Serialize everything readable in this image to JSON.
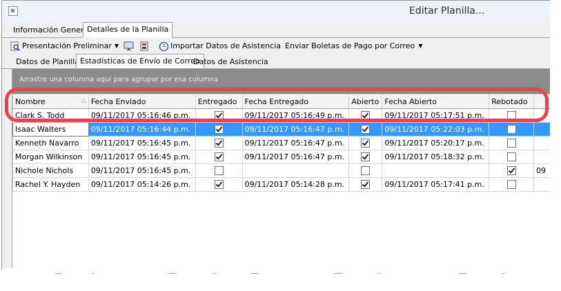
{
  "window": {
    "title": "Editar Planilla..."
  },
  "main_tabs": [
    {
      "label": "Información General"
    },
    {
      "label": "Detalles de la Planilla"
    }
  ],
  "toolbar": {
    "preview_label": "Presentación Preliminar",
    "import_label": "Importar Datos de Asistencia",
    "send_label": "Enviar Boletas de Pago por Correo"
  },
  "sub_tabs": [
    {
      "label": "Datos de Planilla"
    },
    {
      "label": "Estadísticas de Envío de Correo"
    },
    {
      "label": "Datos de Asistencia"
    }
  ],
  "group_panel_text": "Arrastre una columna aquí para agrupar por esa columna",
  "columns": [
    "Nombre",
    "Fecha Enviado",
    "Entregado",
    "Fecha Entregado",
    "Abierto",
    "Fecha Abierto",
    "Rebotado"
  ],
  "rows": [
    {
      "name": "Clark S. Todd",
      "sent": "09/11/2017 05:16:46 p.m.",
      "delivered": true,
      "delivered_date": "09/11/2017 05:16:49 p.m.",
      "opened": true,
      "opened_date": "09/11/2017 05:17:51 p.m.",
      "bounced": false,
      "extra": ""
    },
    {
      "name": "Isaac Walters",
      "sent": "09/11/2017 05:16:44 p.m.",
      "delivered": true,
      "delivered_date": "09/11/2017 05:16:47 p.m.",
      "opened": true,
      "opened_date": "09/11/2017 05:22:03 p.m.",
      "bounced": false,
      "extra": ""
    },
    {
      "name": "Kenneth Navarro",
      "sent": "09/11/2017 05:16:45 p.m.",
      "delivered": true,
      "delivered_date": "09/11/2017 05:16:47 p.m.",
      "opened": true,
      "opened_date": "09/11/2017 05:20:17 p.m.",
      "bounced": false,
      "extra": ""
    },
    {
      "name": "Morgan Wilkinson",
      "sent": "09/11/2017 05:16:45 p.m.",
      "delivered": true,
      "delivered_date": "09/11/2017 05:16:47 p.m.",
      "opened": true,
      "opened_date": "09/11/2017 05:18:32 p.m.",
      "bounced": false,
      "extra": ""
    },
    {
      "name": "Nichole Nichols",
      "sent": "09/11/2017 05:16:45 p.m.",
      "delivered": false,
      "delivered_date": "",
      "opened": false,
      "opened_date": "",
      "bounced": true,
      "extra": "09"
    },
    {
      "name": "Rachel Y. Hayden",
      "sent": "09/11/2017 05:14:26 p.m.",
      "delivered": true,
      "delivered_date": "09/11/2017 05:14:28 p.m.",
      "opened": true,
      "opened_date": "09/11/2017 05:17:41 p.m.",
      "bounced": false,
      "extra": ""
    }
  ],
  "selected_row": 1,
  "colors": {
    "selection": "#3399ff",
    "highlight": "#e8424a",
    "group_panel": "#8b8b8b"
  }
}
